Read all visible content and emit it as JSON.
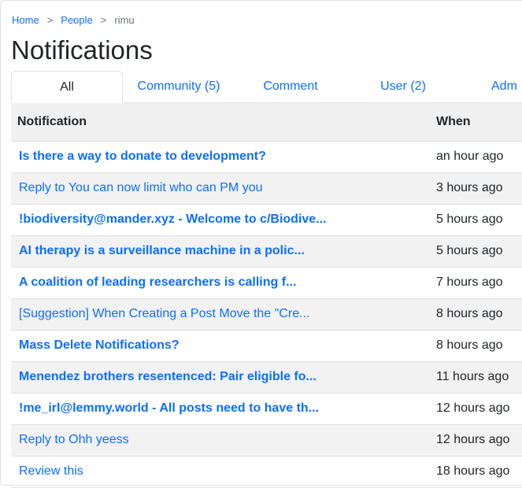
{
  "breadcrumb": {
    "home": "Home",
    "people": "People",
    "current": "rimu",
    "separator": ">"
  },
  "page_title": "Notifications",
  "tabs": [
    {
      "label": "All",
      "active": true
    },
    {
      "label": "Community (5)",
      "active": false
    },
    {
      "label": "Comment",
      "active": false
    },
    {
      "label": "User (2)",
      "active": false
    },
    {
      "label": "Adm",
      "active": false
    }
  ],
  "table": {
    "headers": {
      "notification": "Notification",
      "when": "When"
    },
    "rows": [
      {
        "title": "Is there a way to donate to development?",
        "when": "an hour ago",
        "unread": true
      },
      {
        "title": "Reply to You can now limit who can PM you",
        "when": "3 hours ago",
        "unread": false
      },
      {
        "title": "!biodiversity@mander.xyz - Welcome to c/Biodive...",
        "when": "5 hours ago",
        "unread": true
      },
      {
        "title": "AI therapy is a surveillance machine in a polic...",
        "when": "5 hours ago",
        "unread": true
      },
      {
        "title": "A coalition of leading researchers is calling f...",
        "when": "7 hours ago",
        "unread": true
      },
      {
        "title": "[Suggestion] When Creating a Post Move the \"Cre...",
        "when": "8 hours ago",
        "unread": false
      },
      {
        "title": "Mass Delete Notifications?",
        "when": "8 hours ago",
        "unread": true
      },
      {
        "title": "Menendez brothers resentenced: Pair eligible fo...",
        "when": "11 hours ago",
        "unread": true
      },
      {
        "title": "!me_irl@lemmy.world - All posts need to have th...",
        "when": "12 hours ago",
        "unread": true
      },
      {
        "title": "Reply to Ohh yeess",
        "when": "12 hours ago",
        "unread": false
      },
      {
        "title": "Review this",
        "when": "18 hours ago",
        "unread": false
      }
    ]
  },
  "colors": {
    "link": "#0d6efd",
    "text": "#212529",
    "muted": "#6c757d",
    "header_bg": "#f0f0f0",
    "stripe_bg": "#f2f2f2",
    "border": "#dee2e6"
  }
}
